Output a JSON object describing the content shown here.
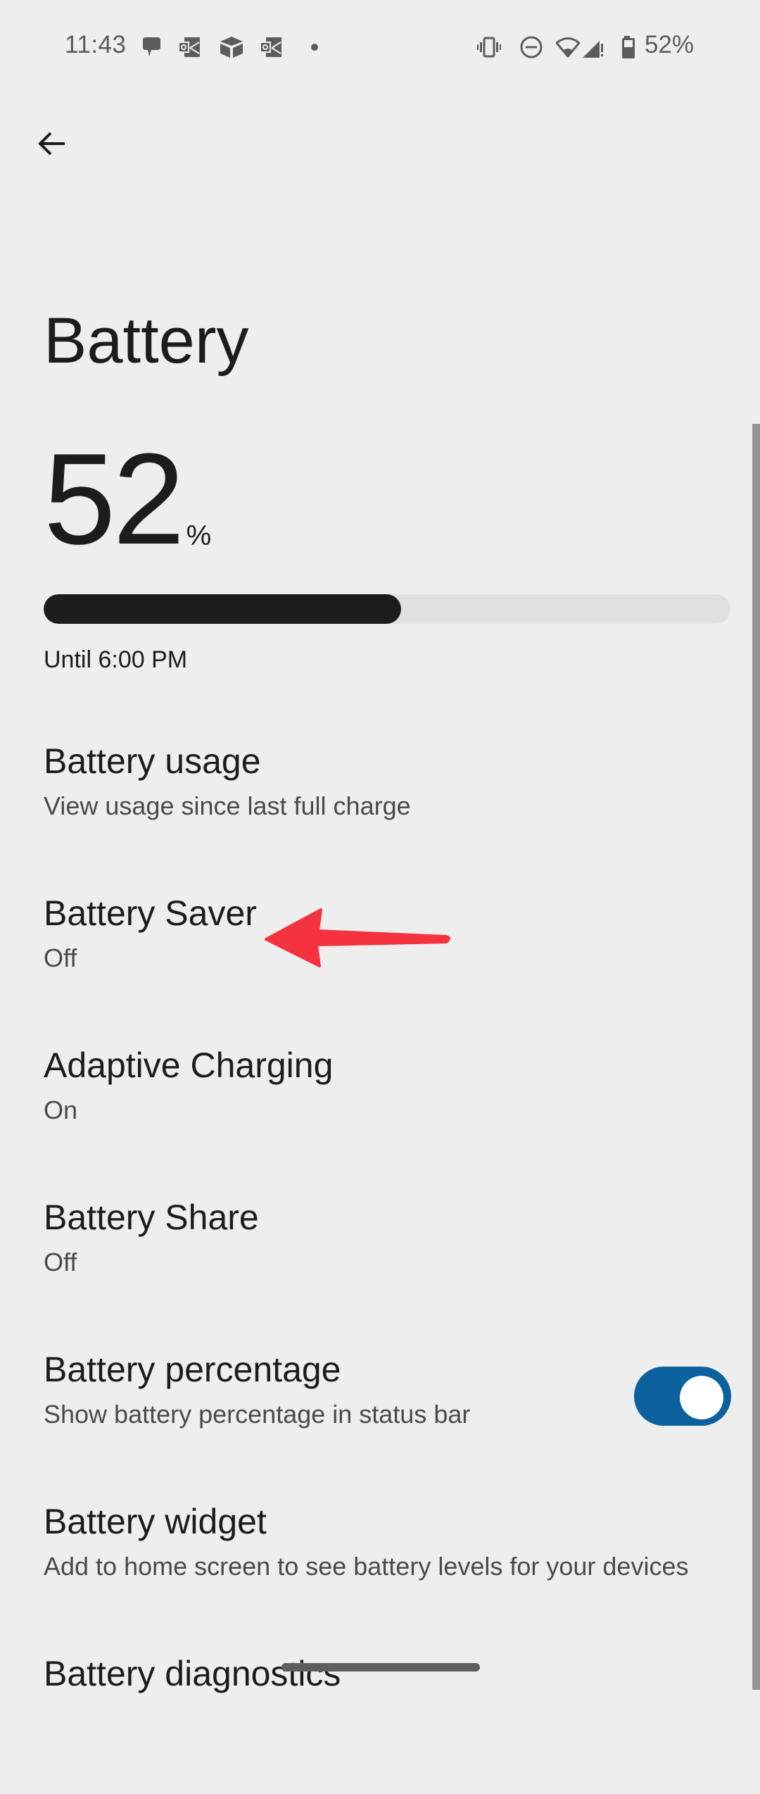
{
  "status_bar": {
    "time": "11:43",
    "notification_icons": [
      "messages-icon",
      "outlook-icon",
      "package-icon",
      "outlook-icon",
      "more-notifications-dot"
    ],
    "system_icons": [
      "vibrate-icon",
      "do-not-disturb-icon",
      "wifi-icon",
      "cellular-no-signal-icon",
      "battery-icon"
    ],
    "battery_text": "52%"
  },
  "header": {
    "back_icon": "arrow-left-icon",
    "title": "Battery"
  },
  "battery": {
    "level_value": "52",
    "level_unit": "%",
    "level_fraction": 0.52,
    "estimate": "Until 6:00 PM"
  },
  "preferences": [
    {
      "title": "Battery usage",
      "summary": "View usage since last full charge"
    },
    {
      "title": "Battery Saver",
      "summary": "Off"
    },
    {
      "title": "Adaptive Charging",
      "summary": "On"
    },
    {
      "title": "Battery Share",
      "summary": "Off"
    },
    {
      "title": "Battery percentage",
      "summary": "Show battery percentage in status bar",
      "toggle_on": true
    },
    {
      "title": "Battery widget",
      "summary": "Add to home screen to see battery levels for your devices"
    },
    {
      "title": "Battery diagnostics"
    }
  ],
  "colors": {
    "background": "#eeeeee",
    "meter_fill": "#1c1c1c",
    "meter_track": "#e0e0e0",
    "toggle_on": "#0b619e",
    "annotation_arrow": "#f5333f"
  },
  "annotation": {
    "type": "arrow",
    "points_to": "Battery Saver"
  }
}
